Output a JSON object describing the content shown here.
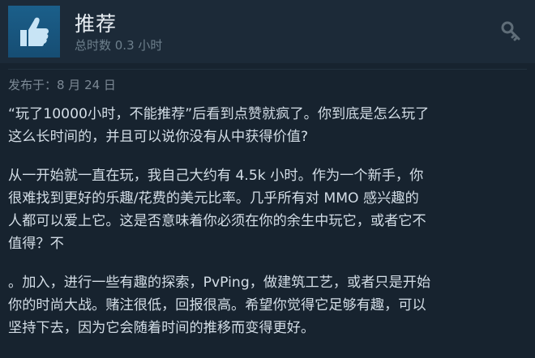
{
  "review_header": {
    "verdict": "推荐",
    "playtime": "总时数 0.3 小时",
    "thumb_icon": "thumbs-up-icon",
    "owner_icon": "key-icon"
  },
  "posted": "发布于：8 月 24 日",
  "body": {
    "p1": [
      "“玩了10000小时，不能推荐”后看到点赞就疯了。你到底是怎么玩了",
      "这么长时间的，并且可以说你没有从中获得价值?"
    ],
    "p2": [
      "从一开始就一直在玩，我自己大约有 4.5k 小时。作为一个新手，你",
      "很难找到更好的乐趣/花费的美元比率。几乎所有对 MMO 感兴趣的",
      "人都可以爱上它。这是否意味着你必须在你的余生中玩它，或者它不",
      "值得？不"
    ],
    "p3": [
      "。加入，进行一些有趣的探索，PvPing，做建筑工艺，或者只是开始",
      "你的时尚大战。赌注很低，回报很高。希望你觉得它足够有趣，可以",
      "坚持下去，因为它会随着时间的推移而变得更好。"
    ]
  },
  "colors": {
    "background": "#17232f",
    "header": "#1c2a38",
    "thumb_box": "#1b5f8a",
    "thumb": "#c8e4f5"
  }
}
